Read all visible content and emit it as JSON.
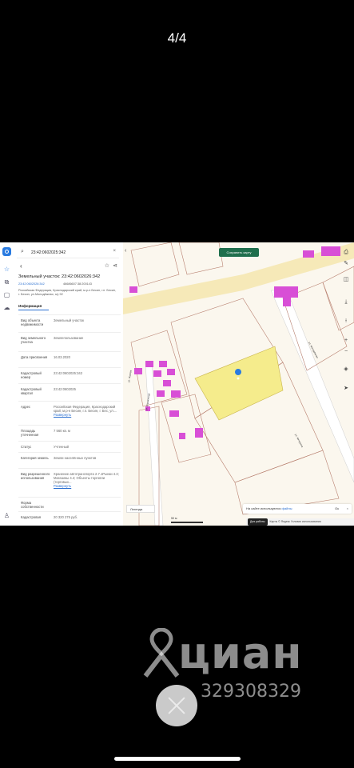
{
  "counter": "4/4",
  "search": {
    "query": "23:42:0602025:342"
  },
  "parcel": {
    "title": "Земельный участок: 23:42:0602026:342",
    "cad_num": "23:42:0602026:342",
    "cad_num2": "46686607:38:200143",
    "address_short": "Российская Федерация, Краснодарский край, м.р-н Бесин, г.п. Бесин, г. Бесин, ул.Молодёжная, з/у 92"
  },
  "tab_info": "Информация",
  "rows": [
    {
      "k": "Вид объекта недвижимости",
      "v": "Земельный участок"
    },
    {
      "k": "Вид земельного участка",
      "v": "Землепользование"
    },
    {
      "k": "Дата присвоения",
      "v": "16.03.2020"
    },
    {
      "k": "Кадастровый номер",
      "v": "23:42:0602025:342"
    },
    {
      "k": "Кадастровый квартал",
      "v": "23:42:0602025"
    },
    {
      "k": "Адрес",
      "v": "Российская Федерация, Краснодарский край, м.р-н Бесин, г.п. Бесин, г. Бес, ул....",
      "more": "Развернуть"
    },
    {
      "k": "Площадь уточненная",
      "v": "7 560 кв. м"
    },
    {
      "k": "Статус",
      "v": "Учтенный"
    },
    {
      "k": "Категория земель",
      "v": "Земли населённых пунктов"
    },
    {
      "k": "Вид разрешенного использования",
      "v": "Хранение автотранспорта 2.7.1Рынки 4.3; Магазины 4.4; Объекты торговли (торговых...",
      "more": "Развернуть"
    },
    {
      "k": "Форма собственности",
      "v": ""
    },
    {
      "k": "Кадастровая",
      "v": "20 320 275 руб."
    }
  ],
  "map": {
    "save_label": "Сохранить карту",
    "legend": "Легенда",
    "scale": "50 м",
    "cookie_text": "На сайте используются",
    "cookie_link": "файлы",
    "cookie_ok": "Ок",
    "footer_badge": "Для работы",
    "footer_text": "Карты © Яндекс   Условия использования",
    "parcel_color": "#f5ec8c",
    "building_color": "#d84fd6",
    "road_color": "#f6e9b8",
    "street_labels": [
      "ул. Строителей",
      "ул. Молодёжная",
      "ул. Мичурина",
      "ул. Жукова"
    ]
  },
  "watermark": {
    "brand": "циан",
    "phone": "329308329"
  }
}
